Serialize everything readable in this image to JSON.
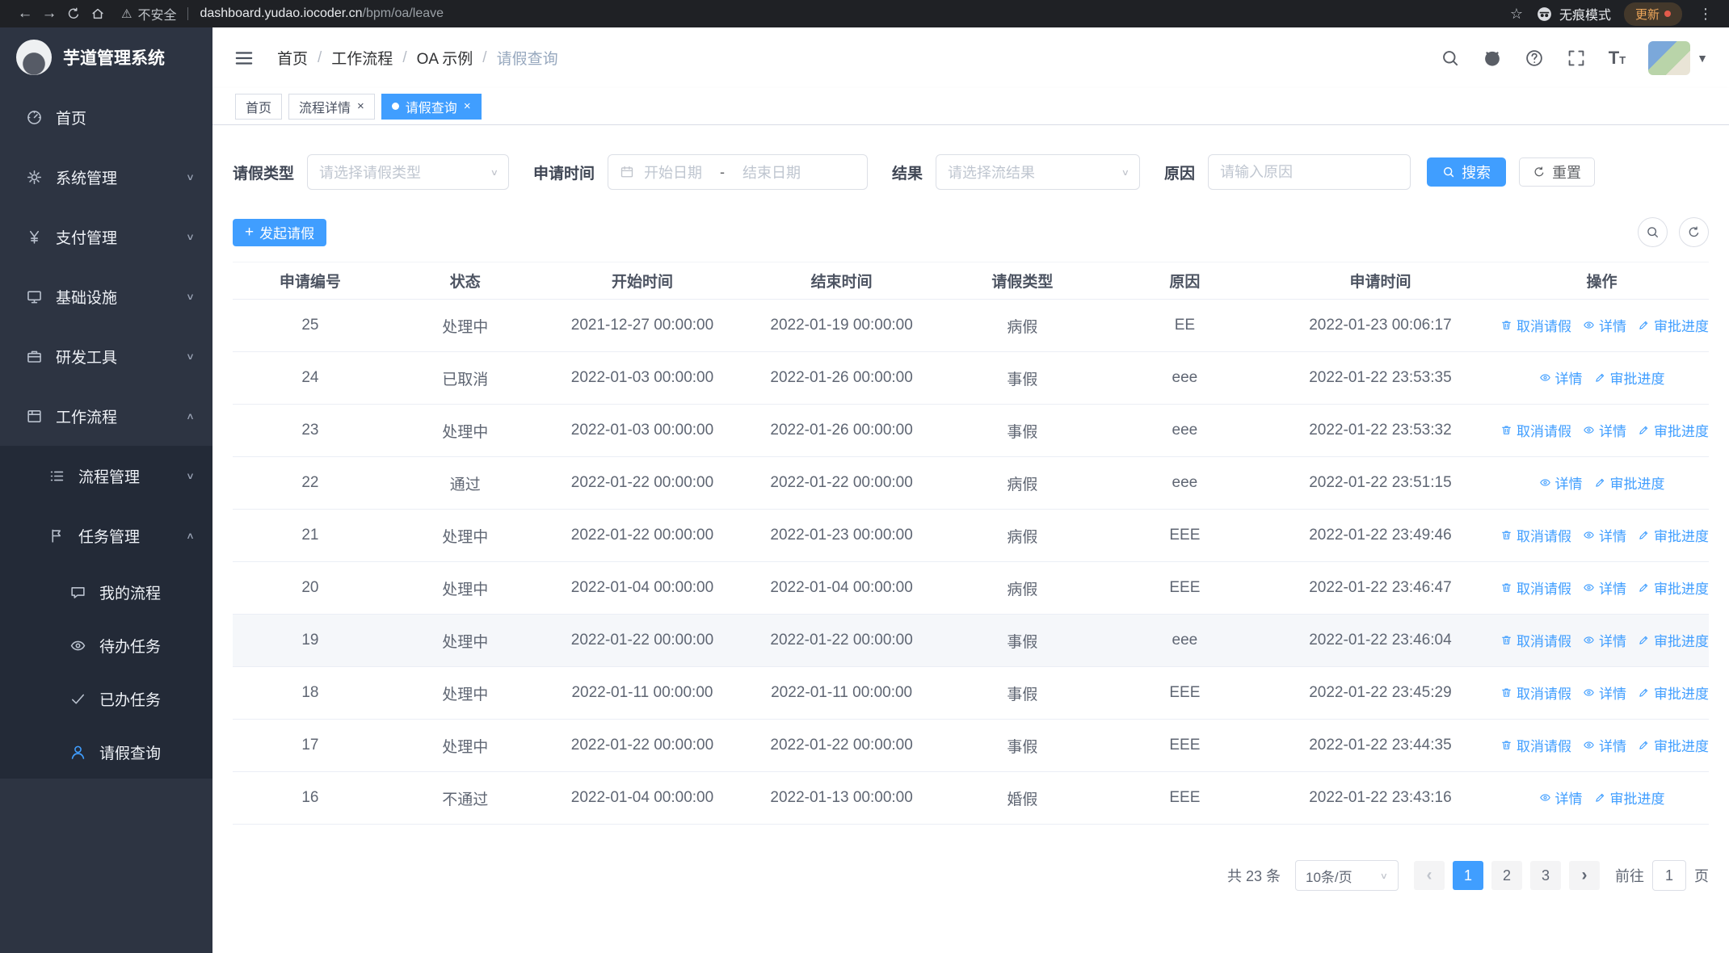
{
  "browser": {
    "security_label": "不安全",
    "url_domain": "dashboard.yudao.iocoder.cn",
    "url_path": "/bpm/oa/leave",
    "incognito_label": "无痕模式",
    "update_label": "更新"
  },
  "sidebar": {
    "logo_title": "芋道管理系统",
    "items": [
      {
        "key": "home",
        "icon": "dashboard-icon",
        "label": "首页"
      },
      {
        "key": "system",
        "icon": "gear-icon",
        "label": "系统管理",
        "arrow": "down"
      },
      {
        "key": "payment",
        "icon": "yen-icon",
        "label": "支付管理",
        "arrow": "down"
      },
      {
        "key": "infra",
        "icon": "infra-icon",
        "label": "基础设施",
        "arrow": "down"
      },
      {
        "key": "devtools",
        "icon": "tools-icon",
        "label": "研发工具",
        "arrow": "down"
      },
      {
        "key": "workflow",
        "icon": "workflow-icon",
        "label": "工作流程",
        "arrow": "up"
      }
    ],
    "sub_items": [
      {
        "key": "process-mgmt",
        "icon": "process-icon",
        "label": "流程管理",
        "arrow": "down"
      },
      {
        "key": "task-mgmt",
        "icon": "task-icon",
        "label": "任务管理",
        "arrow": "up"
      }
    ],
    "leaf_items": [
      {
        "key": "my-process",
        "icon": "chat-icon",
        "label": "我的流程"
      },
      {
        "key": "todo-tasks",
        "icon": "eye-icon",
        "label": "待办任务"
      },
      {
        "key": "done-tasks",
        "icon": "done-icon",
        "label": "已办任务"
      },
      {
        "key": "leave-query",
        "icon": "user-icon",
        "label": "请假查询",
        "active": true
      }
    ]
  },
  "header": {
    "breadcrumb": [
      "首页",
      "工作流程",
      "OA 示例",
      "请假查询"
    ]
  },
  "tabs": [
    {
      "label": "首页",
      "closable": false,
      "active": false
    },
    {
      "label": "流程详情",
      "closable": true,
      "active": false
    },
    {
      "label": "请假查询",
      "closable": true,
      "active": true
    }
  ],
  "filters": {
    "leave_type_label": "请假类型",
    "leave_type_placeholder": "请选择请假类型",
    "apply_time_label": "申请时间",
    "start_date_placeholder": "开始日期",
    "range_separator": "-",
    "end_date_placeholder": "结束日期",
    "result_label": "结果",
    "result_placeholder": "请选择流结果",
    "reason_label": "原因",
    "reason_placeholder": "请输入原因",
    "search_button": "搜索",
    "reset_button": "重置"
  },
  "toolbar": {
    "create_button": "发起请假"
  },
  "table": {
    "columns": [
      "申请编号",
      "状态",
      "开始时间",
      "结束时间",
      "请假类型",
      "原因",
      "申请时间",
      "操作"
    ],
    "actions": {
      "cancel": {
        "label": "取消请假",
        "icon": "trash-icon"
      },
      "detail": {
        "label": "详情",
        "icon": "view-icon"
      },
      "progress": {
        "label": "审批进度",
        "icon": "edit-icon"
      }
    },
    "rows": [
      {
        "id": "25",
        "status": "处理中",
        "start": "2021-12-27 00:00:00",
        "end": "2022-01-19 00:00:00",
        "type": "病假",
        "reason": "EE",
        "apply": "2022-01-23 00:06:17",
        "actions": [
          "cancel",
          "detail",
          "progress"
        ],
        "highlighted": false
      },
      {
        "id": "24",
        "status": "已取消",
        "start": "2022-01-03 00:00:00",
        "end": "2022-01-26 00:00:00",
        "type": "事假",
        "reason": "eee",
        "apply": "2022-01-22 23:53:35",
        "actions": [
          "detail",
          "progress"
        ],
        "highlighted": false
      },
      {
        "id": "23",
        "status": "处理中",
        "start": "2022-01-03 00:00:00",
        "end": "2022-01-26 00:00:00",
        "type": "事假",
        "reason": "eee",
        "apply": "2022-01-22 23:53:32",
        "actions": [
          "cancel",
          "detail",
          "progress"
        ],
        "highlighted": false
      },
      {
        "id": "22",
        "status": "通过",
        "start": "2022-01-22 00:00:00",
        "end": "2022-01-22 00:00:00",
        "type": "病假",
        "reason": "eee",
        "apply": "2022-01-22 23:51:15",
        "actions": [
          "detail",
          "progress"
        ],
        "highlighted": false
      },
      {
        "id": "21",
        "status": "处理中",
        "start": "2022-01-22 00:00:00",
        "end": "2022-01-23 00:00:00",
        "type": "病假",
        "reason": "EEE",
        "apply": "2022-01-22 23:49:46",
        "actions": [
          "cancel",
          "detail",
          "progress"
        ],
        "highlighted": false
      },
      {
        "id": "20",
        "status": "处理中",
        "start": "2022-01-04 00:00:00",
        "end": "2022-01-04 00:00:00",
        "type": "病假",
        "reason": "EEE",
        "apply": "2022-01-22 23:46:47",
        "actions": [
          "cancel",
          "detail",
          "progress"
        ],
        "highlighted": false
      },
      {
        "id": "19",
        "status": "处理中",
        "start": "2022-01-22 00:00:00",
        "end": "2022-01-22 00:00:00",
        "type": "事假",
        "reason": "eee",
        "apply": "2022-01-22 23:46:04",
        "actions": [
          "cancel",
          "detail",
          "progress"
        ],
        "highlighted": true
      },
      {
        "id": "18",
        "status": "处理中",
        "start": "2022-01-11 00:00:00",
        "end": "2022-01-11 00:00:00",
        "type": "事假",
        "reason": "EEE",
        "apply": "2022-01-22 23:45:29",
        "actions": [
          "cancel",
          "detail",
          "progress"
        ],
        "highlighted": false
      },
      {
        "id": "17",
        "status": "处理中",
        "start": "2022-01-22 00:00:00",
        "end": "2022-01-22 00:00:00",
        "type": "事假",
        "reason": "EEE",
        "apply": "2022-01-22 23:44:35",
        "actions": [
          "cancel",
          "detail",
          "progress"
        ],
        "highlighted": false
      },
      {
        "id": "16",
        "status": "不通过",
        "start": "2022-01-04 00:00:00",
        "end": "2022-01-13 00:00:00",
        "type": "婚假",
        "reason": "EEE",
        "apply": "2022-01-22 23:43:16",
        "actions": [
          "detail",
          "progress"
        ],
        "highlighted": false
      }
    ]
  },
  "pagination": {
    "total": "共 23 条",
    "page_size": "10条/页",
    "pages": [
      "1",
      "2",
      "3"
    ],
    "active_page": "1",
    "goto_label": "前往",
    "goto_value": "1",
    "goto_suffix": "页"
  }
}
